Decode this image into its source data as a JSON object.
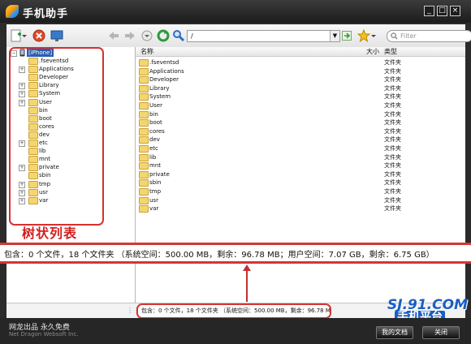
{
  "app": {
    "title": "手机助手"
  },
  "toolbar": {
    "path_value": "/",
    "filter_placeholder": "Filter"
  },
  "tree": {
    "root_label": "[iPhone]",
    "items": [
      {
        "label": ".fseventsd",
        "expandable": false
      },
      {
        "label": "Applications",
        "expandable": true
      },
      {
        "label": "Developer",
        "expandable": false
      },
      {
        "label": "Library",
        "expandable": true
      },
      {
        "label": "System",
        "expandable": true
      },
      {
        "label": "User",
        "expandable": true
      },
      {
        "label": "bin",
        "expandable": false
      },
      {
        "label": "boot",
        "expandable": false
      },
      {
        "label": "cores",
        "expandable": false
      },
      {
        "label": "dev",
        "expandable": false
      },
      {
        "label": "etc",
        "expandable": true
      },
      {
        "label": "lib",
        "expandable": false
      },
      {
        "label": "mnt",
        "expandable": false
      },
      {
        "label": "private",
        "expandable": true
      },
      {
        "label": "sbin",
        "expandable": false
      },
      {
        "label": "tmp",
        "expandable": true
      },
      {
        "label": "usr",
        "expandable": true
      },
      {
        "label": "var",
        "expandable": true
      }
    ],
    "caption": "树状列表"
  },
  "list": {
    "columns": {
      "name": "名称",
      "size": "大小",
      "type": "类型"
    },
    "rows": [
      {
        "name": ".fseventsd",
        "type": "文件夹"
      },
      {
        "name": "Applications",
        "type": "文件夹"
      },
      {
        "name": "Developer",
        "type": "文件夹"
      },
      {
        "name": "Library",
        "type": "文件夹"
      },
      {
        "name": "System",
        "type": "文件夹"
      },
      {
        "name": "User",
        "type": "文件夹"
      },
      {
        "name": "bin",
        "type": "文件夹"
      },
      {
        "name": "boot",
        "type": "文件夹"
      },
      {
        "name": "cores",
        "type": "文件夹"
      },
      {
        "name": "dev",
        "type": "文件夹"
      },
      {
        "name": "etc",
        "type": "文件夹"
      },
      {
        "name": "lib",
        "type": "文件夹"
      },
      {
        "name": "mnt",
        "type": "文件夹"
      },
      {
        "name": "private",
        "type": "文件夹"
      },
      {
        "name": "sbin",
        "type": "文件夹"
      },
      {
        "name": "tmp",
        "type": "文件夹"
      },
      {
        "name": "usr",
        "type": "文件夹"
      },
      {
        "name": "var",
        "type": "文件夹"
      }
    ]
  },
  "callout": {
    "text": "包含：0 个文件，18 个文件夹 （系统空间：500.00 MB，剩余：96.78 MB；用户空间：7.07 GB，剩余：6.75 GB）"
  },
  "status": {
    "text": "包含：0 个文件，18 个文件夹 （系统空间：500.00 MB，剩余：96.78 MB；用户空间：7.07 GB，剩余：6.75 GB）"
  },
  "footer": {
    "vendor": "网龙出品 永久免费",
    "vendor_en": "Net Dragon Websoft Inc.",
    "my_docs": "我的文档",
    "close": "关闭"
  },
  "watermark": {
    "brand": "SJ.91.COM",
    "subtitle": "手机平台"
  },
  "colors": {
    "annotation_red": "#d53535",
    "folder_yellow": "#f5d66d",
    "watermark_blue": "#1a5fc4"
  },
  "icons": [
    "new-icon",
    "delete-icon",
    "monitor-icon",
    "back-arrow-icon",
    "forward-arrow-icon",
    "down-arrow-icon",
    "refresh-icon",
    "search-icon",
    "go-icon",
    "star-icon",
    "phone-icon",
    "folder-icon"
  ]
}
